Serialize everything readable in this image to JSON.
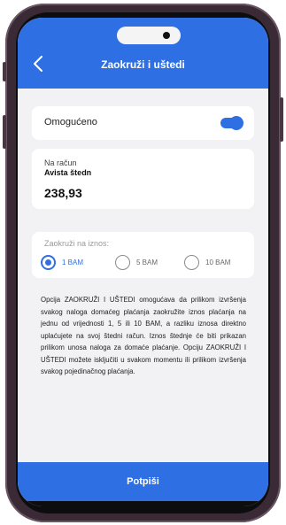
{
  "header": {
    "back_icon": "chevron-left-icon",
    "title": "Zaokruži i uštedi"
  },
  "toggle_card": {
    "label": "Omogućeno",
    "enabled": true,
    "accent": "#2f6fe4"
  },
  "account": {
    "label": "Na račun",
    "name": "Avista štedn",
    "amount": "238,93"
  },
  "round": {
    "label": "Zaokruži na iznos:",
    "options": [
      {
        "label": "1 BAM",
        "selected": true
      },
      {
        "label": "5 BAM",
        "selected": false
      },
      {
        "label": "10 BAM",
        "selected": false
      }
    ]
  },
  "description": "Opcija ZAOKRUŽI I UŠTEDI omogućava da prilikom izvršenja svakog naloga domaćeg plaćanja zaokružite iznos plaćanja na jednu od vrijednosti 1, 5 ili 10 BAM, a razliku iznosa direktno uplaćujete na svoj štedni račun. Iznos štednje će biti prikazan prilikom unosa naloga za domaće plaćanje. Opciju ZAOKRUŽI I UŠTEDI možete isključiti u svakom momentu ili prilikom izvršenja svakog pojedinačnog plaćanja.",
  "submit": {
    "label": "Potpiši"
  },
  "colors": {
    "accent": "#2f6fe4",
    "background": "#f2f2f4",
    "phone_frame": "#3a2a36"
  }
}
